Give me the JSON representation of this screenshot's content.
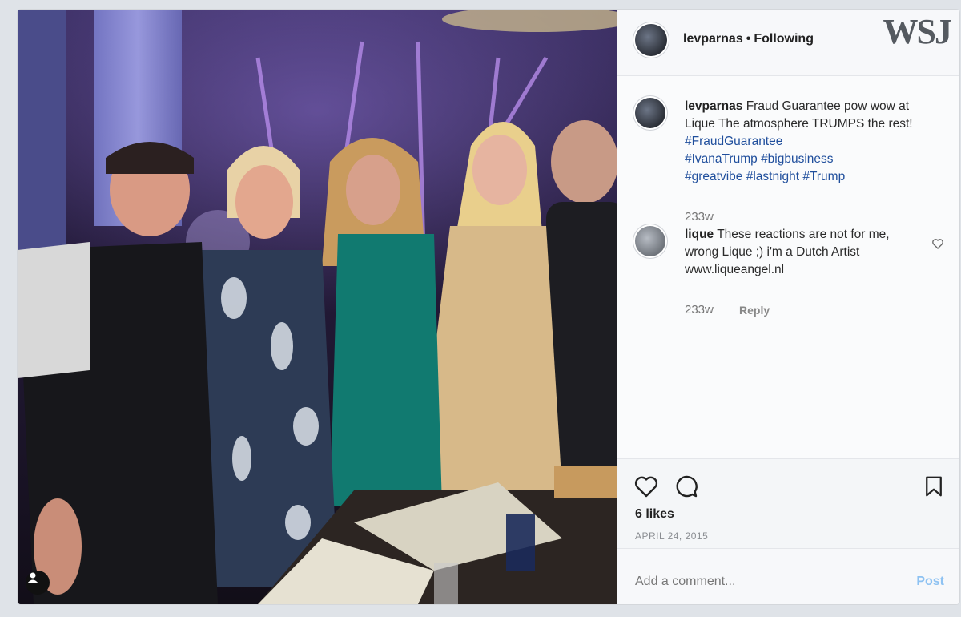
{
  "header": {
    "username": "levparnas",
    "separator": "•",
    "follow_status": "Following",
    "watermark": "WSJ"
  },
  "caption": {
    "username": "levparnas",
    "text": "Fraud Guarantee pow wow at Lique The atmosphere TRUMPS the rest!",
    "hashtags": [
      "#FraudGuarantee",
      "#IvanaTrump",
      "#bigbusiness",
      "#greatvibe",
      "#lastnight",
      "#Trump"
    ],
    "age": "233w"
  },
  "comments": [
    {
      "username": "lique",
      "text": "These reactions are not for me, wrong Lique ;) i'm a Dutch Artist www.liqueangel.nl",
      "age": "233w",
      "reply_label": "Reply"
    }
  ],
  "actions": {
    "likes": "6 likes",
    "date": "APRIL 24, 2015"
  },
  "comment_box": {
    "placeholder": "Add a comment...",
    "post_label": "Post"
  },
  "icons": [
    "heart-icon",
    "comment-icon",
    "bookmark-icon",
    "user-tag-icon"
  ],
  "colors": {
    "link": "#1f4e9c",
    "post_button": "#8ec2f2"
  }
}
